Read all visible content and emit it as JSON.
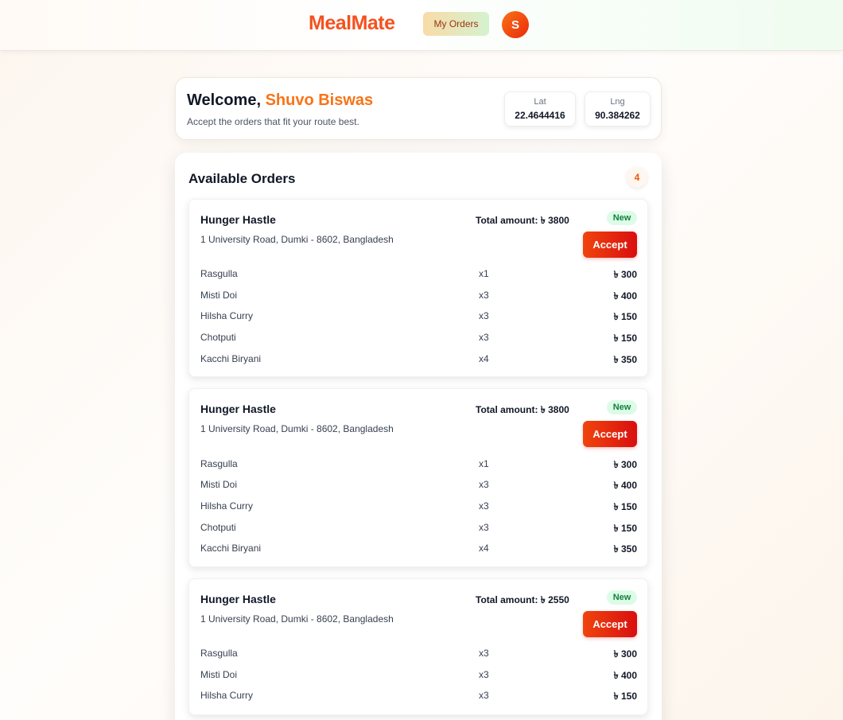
{
  "header": {
    "brand": "MealMate",
    "my_orders_label": "My Orders",
    "avatar_initial": "S"
  },
  "welcome": {
    "greeting": "Welcome,",
    "name": "Shuvo Biswas",
    "subtitle": "Accept the orders that fit your route best.",
    "lat_label": "Lat",
    "lat_value": "22.4644416",
    "lng_label": "Lng",
    "lng_value": "90.384262"
  },
  "orders_panel": {
    "title": "Available Orders",
    "count": "4"
  },
  "orders": [
    {
      "restaurant": "Hunger Hastle",
      "address": "1 University Road, Dumki - 8602, Bangladesh",
      "total_label": "Total amount:",
      "total": "৳ 3800",
      "status": "New",
      "accept_label": "Accept",
      "items": [
        {
          "name": "Rasgulla",
          "qty": "x1",
          "price": "৳ 300"
        },
        {
          "name": "Misti Doi",
          "qty": "x3",
          "price": "৳ 400"
        },
        {
          "name": "Hilsha Curry",
          "qty": "x3",
          "price": "৳ 150"
        },
        {
          "name": "Chotputi",
          "qty": "x3",
          "price": "৳ 150"
        },
        {
          "name": "Kacchi Biryani",
          "qty": "x4",
          "price": "৳ 350"
        }
      ]
    },
    {
      "restaurant": "Hunger Hastle",
      "address": "1 University Road, Dumki - 8602, Bangladesh",
      "total_label": "Total amount:",
      "total": "৳ 3800",
      "status": "New",
      "accept_label": "Accept",
      "items": [
        {
          "name": "Rasgulla",
          "qty": "x1",
          "price": "৳ 300"
        },
        {
          "name": "Misti Doi",
          "qty": "x3",
          "price": "৳ 400"
        },
        {
          "name": "Hilsha Curry",
          "qty": "x3",
          "price": "৳ 150"
        },
        {
          "name": "Chotputi",
          "qty": "x3",
          "price": "৳ 150"
        },
        {
          "name": "Kacchi Biryani",
          "qty": "x4",
          "price": "৳ 350"
        }
      ]
    },
    {
      "restaurant": "Hunger Hastle",
      "address": "1 University Road, Dumki - 8602, Bangladesh",
      "total_label": "Total amount:",
      "total": "৳ 2550",
      "status": "New",
      "accept_label": "Accept",
      "items": [
        {
          "name": "Rasgulla",
          "qty": "x3",
          "price": "৳ 300"
        },
        {
          "name": "Misti Doi",
          "qty": "x3",
          "price": "৳ 400"
        },
        {
          "name": "Hilsha Curry",
          "qty": "x3",
          "price": "৳ 150"
        }
      ]
    }
  ]
}
